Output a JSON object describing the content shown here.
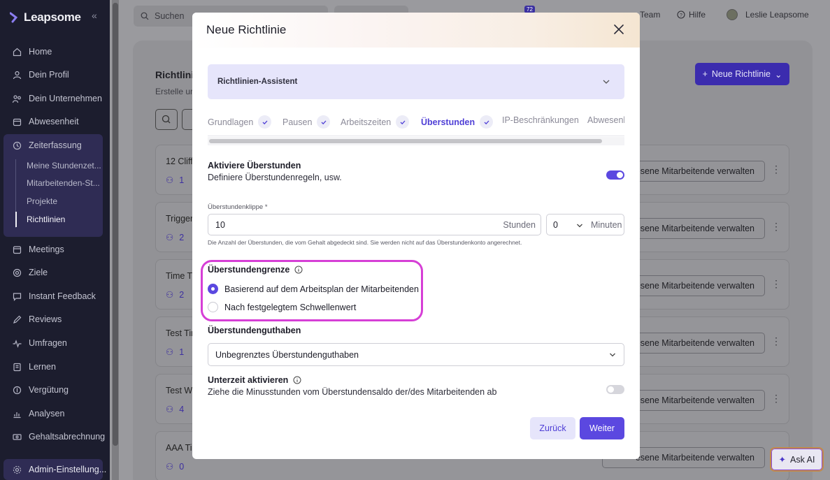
{
  "sidebar": {
    "brand": "Leapsome",
    "items": [
      {
        "label": "Home",
        "icon": "home-icon"
      },
      {
        "label": "Dein Profil",
        "icon": "user-icon"
      },
      {
        "label": "Dein Unternehmen",
        "icon": "company-icon"
      },
      {
        "label": "Abwesenheit",
        "icon": "absence-icon"
      },
      {
        "label": "Zeiterfassung",
        "icon": "clock-icon"
      },
      {
        "label": "Meetings",
        "icon": "calendar-icon"
      },
      {
        "label": "Ziele",
        "icon": "target-icon"
      },
      {
        "label": "Instant Feedback",
        "icon": "chat-icon"
      },
      {
        "label": "Reviews",
        "icon": "pen-icon"
      },
      {
        "label": "Umfragen",
        "icon": "pulse-icon"
      },
      {
        "label": "Lernen",
        "icon": "book-icon"
      },
      {
        "label": "Vergütung",
        "icon": "coins-icon"
      },
      {
        "label": "Analysen",
        "icon": "chart-icon"
      },
      {
        "label": "Gehaltsabrechnung",
        "icon": "money-icon"
      },
      {
        "label": "Admin-Einstellung...",
        "icon": "gear-icon"
      }
    ],
    "sub_items": [
      "Meine Stundenzet...",
      "Mitarbeitenden-St...",
      "Projekte",
      "Richtlinien"
    ],
    "active_sub": "Richtlinien"
  },
  "topbar": {
    "search_placeholder": "Suchen",
    "badge": "72",
    "team": "Team",
    "help": "Hilfe",
    "user": "Leslie Leapsome"
  },
  "background": {
    "title": "Richtlini",
    "subtitle": "Erstelle ur",
    "new_policy_button": "Neue Richtlinie",
    "rows": [
      {
        "name": "12 Cliff",
        "count": "1",
        "action": "esene Mitarbeitende verwalten"
      },
      {
        "name": "Trigger",
        "count": "2",
        "action": "esene Mitarbeitende verwalten"
      },
      {
        "name": "Time Tr",
        "count": "2",
        "action": "esene Mitarbeitende verwalten"
      },
      {
        "name": "Test Tir",
        "count": "1",
        "action": "esene Mitarbeitende verwalten"
      },
      {
        "name": "Test We",
        "count": "4",
        "action": "esene Mitarbeitende verwalten"
      },
      {
        "name": "AAA Ti",
        "count": "0",
        "action": "esene Mitarbeitende verwalten"
      }
    ],
    "ask_ai": "Ask AI"
  },
  "modal": {
    "title": "Neue Richtlinie",
    "assistant_label": "Richtlinien-Assistent",
    "steps": [
      {
        "label": "Grundlagen",
        "done": true,
        "active": false
      },
      {
        "label": "Pausen",
        "done": true,
        "active": false
      },
      {
        "label": "Arbeitszeiten",
        "done": true,
        "active": false
      },
      {
        "label": "Überstunden",
        "done": true,
        "active": true
      },
      {
        "label": "IP-Beschränkungen",
        "done": false,
        "active": false
      },
      {
        "label": "Abwesenl",
        "done": false,
        "active": false
      }
    ],
    "overtime": {
      "title": "Aktiviere Überstunden",
      "description": "Definiere Überstundenregeln, usw.",
      "enabled": true
    },
    "cliff": {
      "label": "Überstundenklippe *",
      "hours_value": "10",
      "hours_unit": "Stunden",
      "minutes_value": "0",
      "minutes_unit": "Minuten",
      "help": "Die Anzahl der Überstunden, die vom Gehalt abgedeckt sind. Sie werden nicht auf das Überstundenkonto angerechnet."
    },
    "limit": {
      "title": "Überstundengrenze",
      "options": [
        {
          "label": "Basierend auf dem Arbeitsplan der Mitarbeitenden",
          "selected": true
        },
        {
          "label": "Nach festgelegtem Schwellenwert",
          "selected": false
        }
      ]
    },
    "balance": {
      "title": "Überstundenguthaben",
      "value": "Unbegrenztes Überstundenguthaben"
    },
    "undertime": {
      "title": "Unterzeit aktivieren",
      "description": "Ziehe die Minusstunden vom Überstundensaldo der/des Mitarbeitenden ab",
      "enabled": false
    },
    "back_button": "Zurück",
    "next_button": "Weiter"
  },
  "colors": {
    "accent": "#5b48e0",
    "sidebar_bg": "#1c1d2e",
    "highlight": "#d63fd6"
  }
}
